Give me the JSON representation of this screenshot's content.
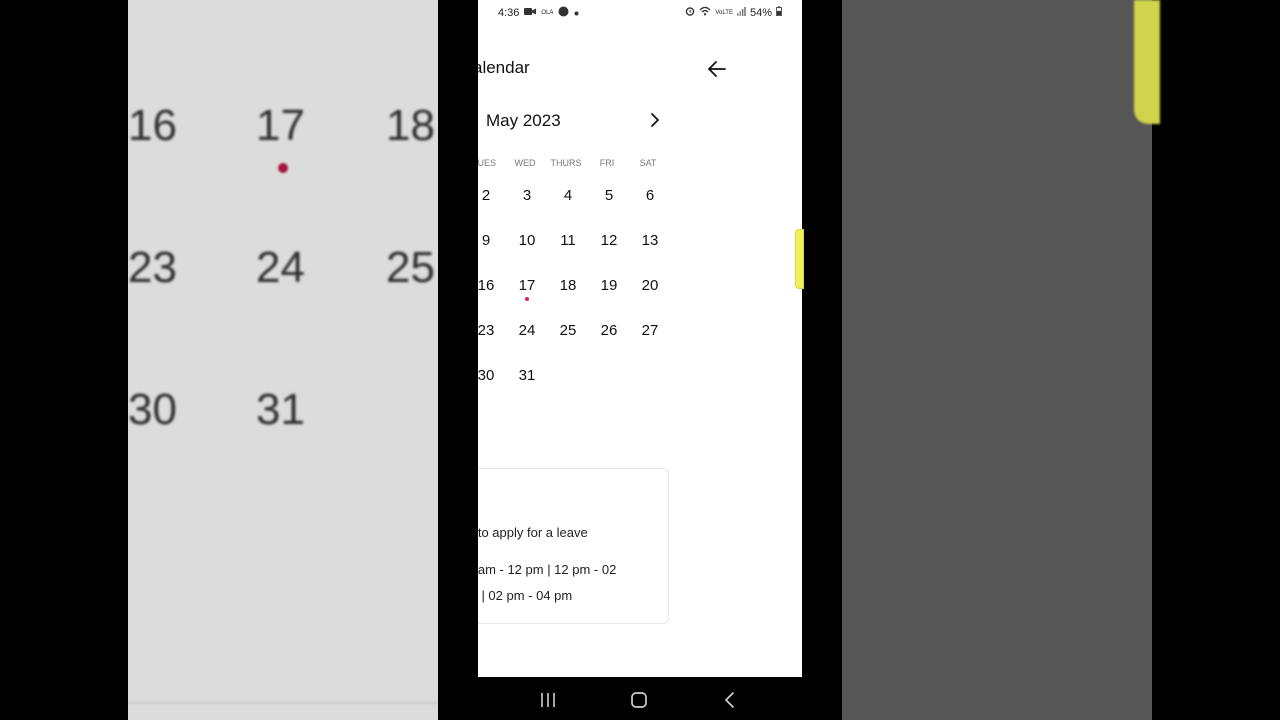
{
  "status_bar": {
    "time": "4:36",
    "carrier_tag": "OLA",
    "network": "VoLTE",
    "battery": "54%"
  },
  "header": {
    "title": "alendar"
  },
  "calendar": {
    "month_label": "May 2023",
    "weekdays": [
      "UES",
      "WED",
      "THURS",
      "FRI",
      "SAT"
    ],
    "weeks": [
      [
        "2",
        "3",
        "4",
        "5",
        "6"
      ],
      [
        "9",
        "10",
        "11",
        "12",
        "13"
      ],
      [
        "16",
        "17",
        "18",
        "19",
        "20"
      ],
      [
        "23",
        "24",
        "25",
        "26",
        "27"
      ],
      [
        "30",
        "31"
      ]
    ]
  },
  "leave_card": {
    "instruction": "e to apply for a leave",
    "slots_line1": "0 am - 12 pm | 12 pm - 02",
    "slots_line2": "m | 02 pm - 04 pm"
  },
  "background_blur": {
    "left_numbers": [
      "16",
      "17",
      "18",
      "23",
      "24",
      "25",
      "30",
      "31"
    ]
  },
  "colors": {
    "accent": "#ef2f5c",
    "event_dot": "#e0245e",
    "side_tab": "#eef05c"
  },
  "icons": {
    "back": "arrow-left-icon",
    "next": "chevron-right-icon"
  }
}
